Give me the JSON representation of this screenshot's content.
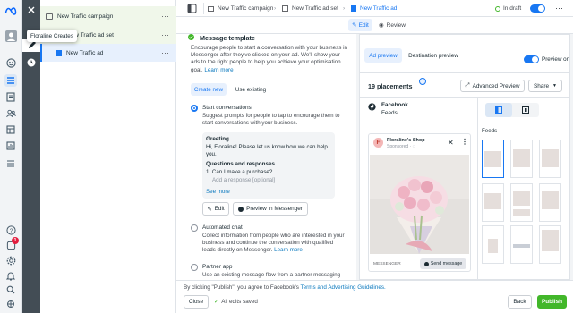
{
  "tooltip": "Floraline Creates",
  "tree": {
    "campaign": "New Traffic campaign",
    "adset": "New Traffic ad set",
    "ad": "New Traffic ad"
  },
  "topbar": {
    "crumb_campaign": "New Traffic campaign",
    "crumb_adset": "New Traffic ad set",
    "crumb_ad": "New Traffic ad",
    "status": "In draft"
  },
  "subbar": {
    "edit": "Edit",
    "review": "Review"
  },
  "editor": {
    "section_title": "Message template",
    "description": "Encourage people to start a conversation with your business in Messenger after they've clicked on your ad. We'll show your ads to the right people to help you achieve your optimisation goal.",
    "learn_more": "Learn more",
    "tab_create": "Create new",
    "tab_existing": "Use existing",
    "option1_title": "Start conversations",
    "option1_desc": "Suggest prompts for people to tap to encourage them to start conversations with your business.",
    "greeting_label": "Greeting",
    "greeting_text": "Hi, Floraline! Please let us know how we can help you.",
    "qa_label": "Questions and responses",
    "qa_item": "1. Can I make a purchase?",
    "qa_placeholder": "Add a response [optional]",
    "see_more": "See more",
    "edit_button": "Edit",
    "preview_messenger": "Preview in Messenger",
    "option2_title": "Automated chat",
    "option2_desc": "Collect information from people who are interested in your business and continue the conversation with qualified leads directly on Messenger.",
    "option2_link": "Learn more",
    "option3_title": "Partner app",
    "option3_desc": "Use an existing message flow from a partner messaging"
  },
  "preview": {
    "tab_ad": "Ad preview",
    "tab_destination": "Destination preview",
    "preview_on": "Preview on",
    "placements": "19 placements",
    "advanced": "Advanced Preview",
    "share": "Share",
    "platform": "Facebook",
    "platform_sub": "Feeds",
    "feeds_label": "Feeds",
    "page_name": "Floraline's Shop",
    "sponsored": "Sponsored",
    "page_initial": "F",
    "messenger_label": "MESSENGER",
    "send_message": "Send message"
  },
  "footer": {
    "agree_text": "By clicking \"Publish\", you agree to Facebook's",
    "terms_link": "Terms and Advertising Guidelines.",
    "close": "Close",
    "saved": "All edits saved",
    "back": "Back",
    "publish": "Publish"
  },
  "colors": {
    "accent": "#1877f2",
    "publish": "#42b72a",
    "dark_nav": "#434d55",
    "draft": "#42b72a",
    "notification": "#e41e3f"
  },
  "rail_badge": "1"
}
